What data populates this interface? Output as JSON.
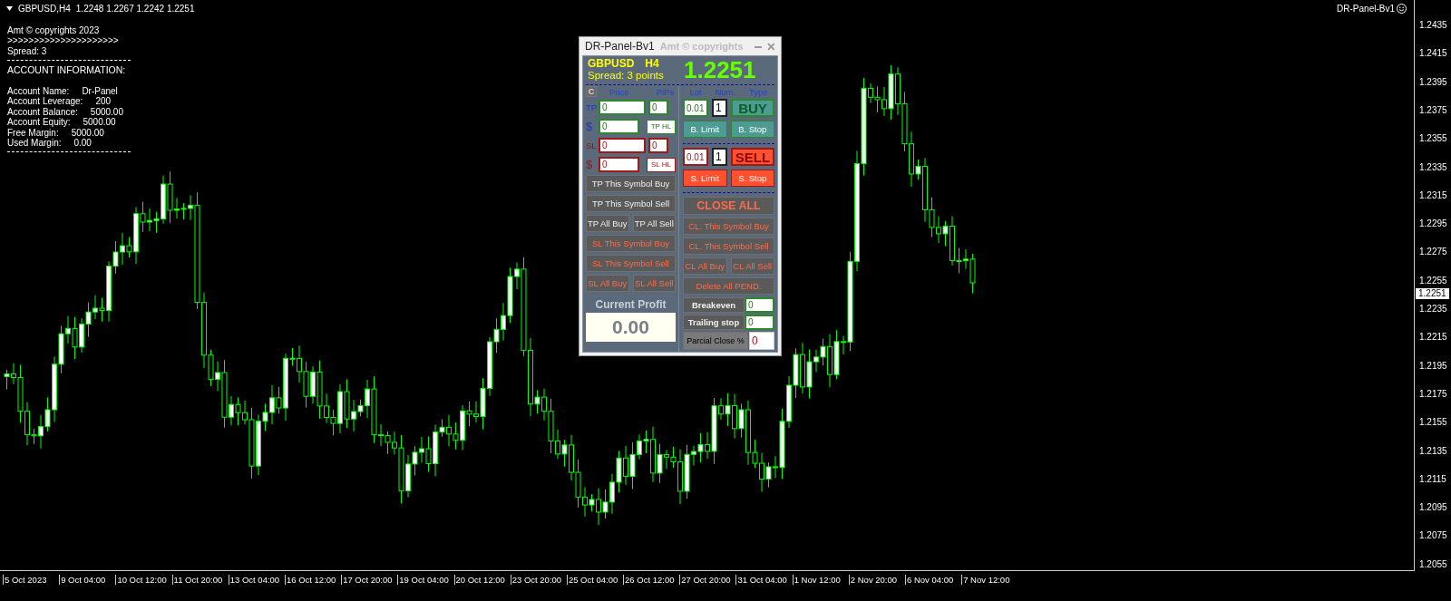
{
  "chart_header": {
    "symbol": "GBPUSD,H4",
    "ohlc": "1.2248 1.2267 1.2242 1.2251"
  },
  "expert_label": "DR-Panel-Bv1",
  "info_lines": [
    {
      "kind": "text",
      "text": "Amt © copyrights 2023"
    },
    {
      "kind": "text",
      "text": ">>>>>>>>>>>>>>>>>>>>>"
    },
    {
      "kind": "text",
      "text": "Spread: 3"
    },
    {
      "kind": "rule"
    },
    {
      "kind": "heading",
      "text": "ACCOUNT INFORMATION:"
    },
    {
      "kind": "blank"
    },
    {
      "kind": "field",
      "label": "Account Name:",
      "value": "Dr-Panel"
    },
    {
      "kind": "field",
      "label": "Account Leverage:",
      "value": "200"
    },
    {
      "kind": "field",
      "label": "Account Balance:",
      "value": "5000.00"
    },
    {
      "kind": "field",
      "label": "Account Equity:",
      "value": "5000.00"
    },
    {
      "kind": "field",
      "label": "Free Margin:",
      "value": "5000.00"
    },
    {
      "kind": "field",
      "label": "Used Margin:",
      "value": "0.00"
    },
    {
      "kind": "rule"
    }
  ],
  "price_axis": {
    "labels": [
      "1.2435",
      "1.2415",
      "1.2395",
      "1.2375",
      "1.2355",
      "1.2335",
      "1.2315",
      "1.2295",
      "1.2275",
      "1.2255",
      "1.2235",
      "1.2215",
      "1.2195",
      "1.2175",
      "1.2155",
      "1.2135",
      "1.2115",
      "1.2095",
      "1.2075",
      "1.2055"
    ],
    "current": "1.2251"
  },
  "time_axis": [
    "5 Oct 2023",
    "9 Oct 04:00",
    "10 Oct 12:00",
    "11 Oct 20:00",
    "13 Oct 04:00",
    "16 Oct 12:00",
    "17 Oct 20:00",
    "19 Oct 04:00",
    "20 Oct 12:00",
    "23 Oct 20:00",
    "25 Oct 04:00",
    "26 Oct 12:00",
    "27 Oct 20:00",
    "31 Oct 04:00",
    "1 Nov 12:00",
    "2 Nov 20:00",
    "6 Nov 04:00",
    "7 Nov 12:00"
  ],
  "panel": {
    "title": "DR-Panel-Bv1",
    "subtitle": "Amt © copyrights",
    "symbol": "GBPUSD",
    "timeframe": "H4",
    "spread": "Spread: 3 points",
    "price": "1.2251",
    "clear_button": "C",
    "price_heading": "Price",
    "pips_heading": "PiPs",
    "level_rows": [
      {
        "label": "TP",
        "kind": "tp",
        "price": "0",
        "pips": "0"
      },
      {
        "label": "$",
        "kind": "tp",
        "price": "0",
        "button": "TP HL"
      },
      {
        "label": "SL",
        "kind": "sl",
        "price": "0",
        "pips": "0"
      },
      {
        "label": "$",
        "kind": "sl",
        "price": "0",
        "button": "SL HL"
      }
    ],
    "left_buttons": [
      [
        {
          "label": "TP This Symbol Buy",
          "kind": "tp"
        }
      ],
      [
        {
          "label": "TP This Symbol Sell",
          "kind": "tp"
        }
      ],
      [
        {
          "label": "TP All Buy",
          "kind": "tp"
        },
        {
          "label": "TP All Sell",
          "kind": "tp"
        }
      ],
      [
        {
          "label": "SL This Symbol Buy",
          "kind": "sl"
        }
      ],
      [
        {
          "label": "SL This Symbol Sell",
          "kind": "sl"
        }
      ],
      [
        {
          "label": "SL All Buy",
          "kind": "sl"
        },
        {
          "label": "SL All Sell",
          "kind": "sl"
        }
      ]
    ],
    "profit_label": "Current Profit",
    "profit_value": "0.00",
    "lot_heading": "Lot",
    "num_heading": "Num.",
    "type_heading": "Type",
    "orders": [
      {
        "kind": "buy",
        "lot": "0.01",
        "num": "1",
        "action": "BUY",
        "pending": [
          "B. Limit",
          "B. Stop"
        ]
      },
      {
        "kind": "sell",
        "lot": "0.01",
        "num": "1",
        "action": "SELL",
        "pending": [
          "S. Limit",
          "S. Stop"
        ]
      }
    ],
    "right_buttons": [
      [
        {
          "label": "CLOSE ALL",
          "kind": "big"
        }
      ],
      [
        {
          "label": "CL. This Symbol Buy",
          "kind": "sl"
        }
      ],
      [
        {
          "label": "CL. This Symbol Sell",
          "kind": "sl"
        }
      ],
      [
        {
          "label": "CL All Buy",
          "kind": "sl"
        },
        {
          "label": "CL All Sell",
          "kind": "sl"
        }
      ],
      [
        {
          "label": "Delete All PEND.",
          "kind": "sl"
        }
      ]
    ],
    "settings": [
      {
        "label": "Breakeven",
        "kind": "tp",
        "value": "0"
      },
      {
        "label": "Trailing stop",
        "kind": "tp",
        "value": "0"
      },
      {
        "label": "Parcial Close %",
        "kind": "sl",
        "value": "0"
      }
    ]
  }
}
